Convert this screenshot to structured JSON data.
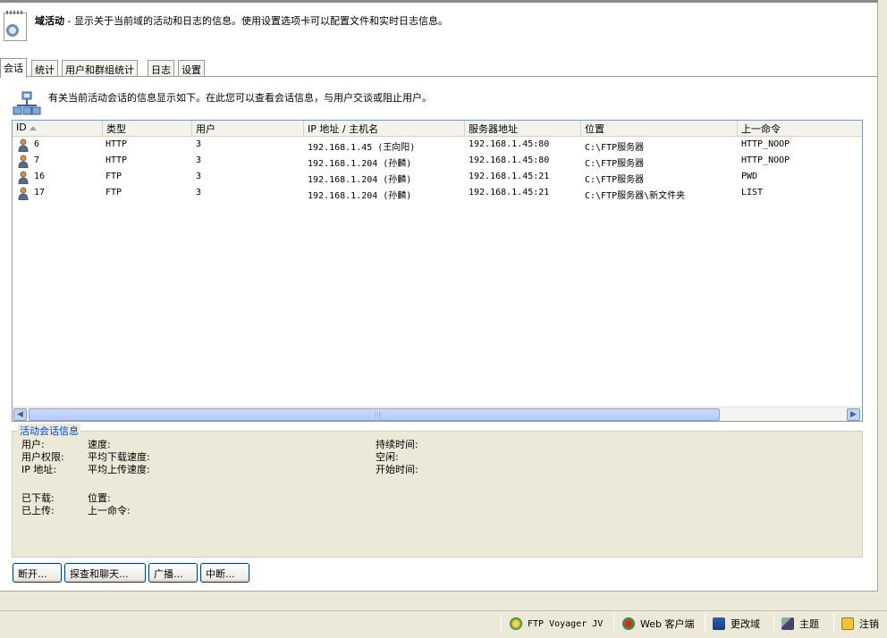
{
  "header": {
    "title": "域活动",
    "separator": " - ",
    "description": "显示关于当前域的活动和日志的信息。使用设置选项卡可以配置文件和实时日志信息。"
  },
  "tabs": [
    {
      "label": "会话",
      "active": true
    },
    {
      "label": "统计",
      "active": false
    },
    {
      "label": "用户和群组统计",
      "active": false
    },
    {
      "label": "日志",
      "active": false
    },
    {
      "label": "设置",
      "active": false
    }
  ],
  "info_text": "有关当前活动会话的信息显示如下。在此您可以查看会话信息，与用户交谈或阻止用户。",
  "table": {
    "columns": [
      "ID",
      "类型",
      "用户",
      "IP 地址 / 主机名",
      "服务器地址",
      "位置",
      "上一命令"
    ],
    "rows": [
      {
        "id": "6",
        "type": "HTTP",
        "user": "3",
        "ip": "192.168.1.45 (王向阳)",
        "server": "192.168.1.45:80",
        "location": "C:\\FTP服务器",
        "command": "HTTP_NOOP"
      },
      {
        "id": "7",
        "type": "HTTP",
        "user": "3",
        "ip": "192.168.1.204 (孙麟)",
        "server": "192.168.1.45:80",
        "location": "C:\\FTP服务器",
        "command": "HTTP_NOOP"
      },
      {
        "id": "16",
        "type": "FTP",
        "user": "3",
        "ip": "192.168.1.204 (孙麟)",
        "server": "192.168.1.45:21",
        "location": "C:\\FTP服务器",
        "command": "PWD"
      },
      {
        "id": "17",
        "type": "FTP",
        "user": "3",
        "ip": "192.168.1.204 (孙麟)",
        "server": "192.168.1.45:21",
        "location": "C:\\FTP服务器\\新文件夹",
        "command": "LIST"
      }
    ]
  },
  "active_session": {
    "legend": "活动会话信息",
    "user": "用户:",
    "speed": "速度:",
    "duration": "持续时间:",
    "permissions": "用户权限:",
    "avg_download": "平均下载速度:",
    "idle": "空闲:",
    "ip": "IP 地址:",
    "avg_upload": "平均上传速度:",
    "start_time": "开始时间:",
    "downloaded": "已下载:",
    "location": "位置:",
    "uploaded": "已上传:",
    "last_command": "上一命令:"
  },
  "buttons": {
    "disconnect": "断开...",
    "spy_chat": "探查和聊天...",
    "broadcast": "广播...",
    "interrupt": "中断..."
  },
  "status_bar": {
    "ftp_voyager": "FTP Voyager JV",
    "web_client": "Web 客户端",
    "change_domain": "更改域",
    "theme": "主题",
    "logout": "注销"
  },
  "colors": {
    "legend_text": "#0046d5",
    "scroll_thumb": "#c1d3fb",
    "chrome": "#ece9d8"
  }
}
